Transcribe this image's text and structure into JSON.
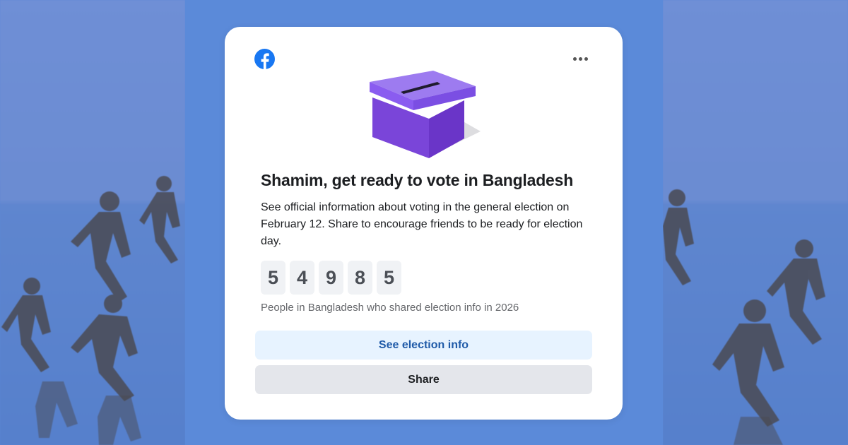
{
  "card": {
    "title": "Shamim, get ready to vote in Bangladesh",
    "description": "See official information about voting in the general election on February 12. Share to encourage friends to be ready for election day.",
    "counter_digits": [
      "5",
      "4",
      "9",
      "8",
      "5"
    ],
    "counter_caption": "People in Bangladesh who shared election info in 2026",
    "primary_button": "See election info",
    "secondary_button": "Share"
  },
  "icons": {
    "logo": "facebook-logo-icon",
    "menu": "more-options-icon",
    "illustration": "ballot-box-icon"
  },
  "colors": {
    "background_blue": "#5b8ad9",
    "facebook_blue": "#1877f2",
    "ballot_purple": "#8a5cf0",
    "primary_button_bg": "#e7f3ff",
    "primary_button_text": "#1f5aa8",
    "secondary_button_bg": "#e4e6eb"
  }
}
